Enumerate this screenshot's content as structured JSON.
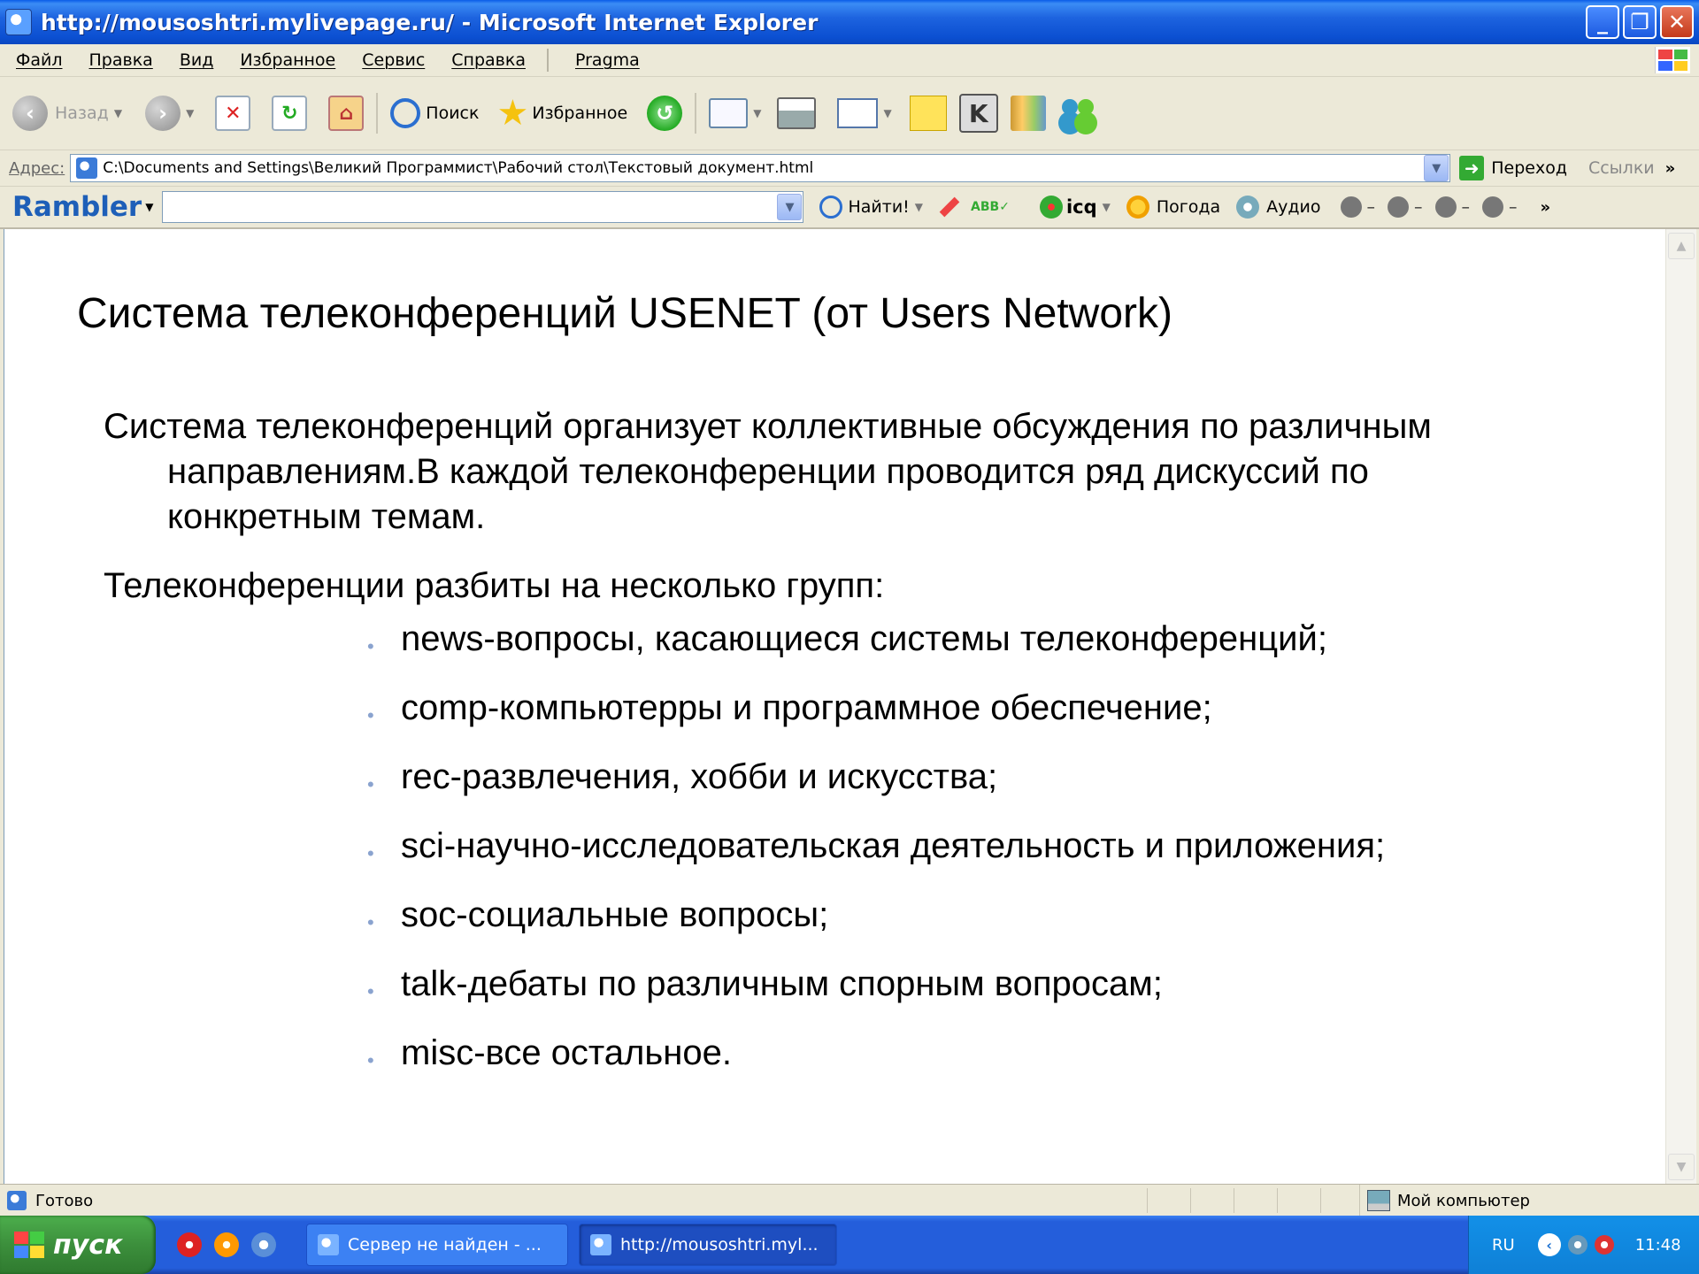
{
  "window": {
    "title": "http://mousoshtri.mylivepage.ru/ - Microsoft Internet Explorer",
    "minimize": "_",
    "maximize": "❐",
    "close": "✕"
  },
  "menu": {
    "items": [
      "Файл",
      "Правка",
      "Вид",
      "Избранное",
      "Сервис",
      "Справка",
      "Pragma"
    ]
  },
  "toolbar": {
    "back_label": "Назад",
    "search_label": "Поиск",
    "favorites_label": "Избранное"
  },
  "address": {
    "label": "Адрес:",
    "value": "C:\\Documents and Settings\\Великий Программист\\Рабочий стол\\Текстовый документ.html",
    "go_label": "Переход",
    "links_label": "Ссылки"
  },
  "rambler": {
    "logo": "Rambler",
    "search_value": "",
    "find_label": "Найти!",
    "icq_label": "icq",
    "weather_label": "Погода",
    "audio_label": "Аудио"
  },
  "page": {
    "title": "Система телеконференций USENET (от Users Network)",
    "intro": "Система телеконференций организует коллективные обсуждения по различным направлениям.В каждой телеконференции проводится ряд дискуссий по конкретным темам.",
    "groups_heading": "Телеконференции разбиты на несколько групп:",
    "groups": [
      "news-вопросы, касающиеся системы телеконференций;",
      "comp-компьютерры и программное обеспечение;",
      "rec-развлечения, хобби и искусства;",
      "sci-научно-исследовательская деятельность и приложения;",
      "soc-социальные вопросы;",
      "talk-дебаты по различным спорным вопросам;",
      "misc-все остальное."
    ]
  },
  "status": {
    "text": "Готово",
    "zone": "Мой компьютер"
  },
  "taskbar": {
    "start_label": "пуск",
    "tasks": [
      "Сервер не найден - ...",
      "http://mousoshtri.myl..."
    ],
    "language": "RU",
    "clock": "11:48"
  },
  "colors": {
    "titlebar": "#0b4fd1",
    "taskbar": "#245edb",
    "start": "#3c8f3c",
    "bullet": "#8aa3cf"
  }
}
